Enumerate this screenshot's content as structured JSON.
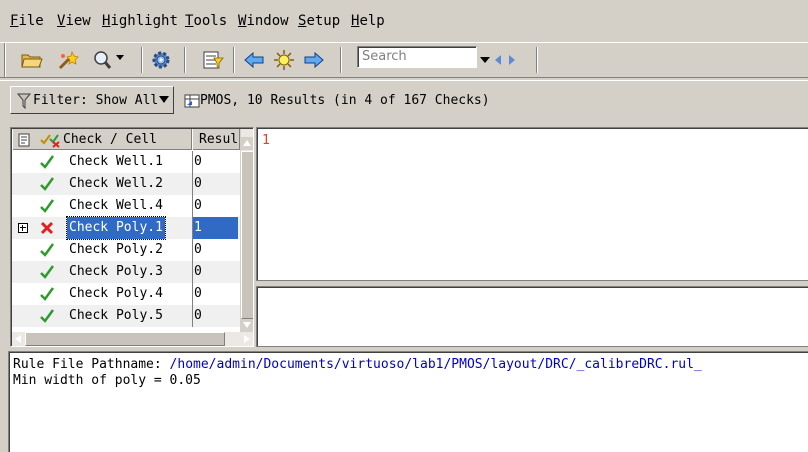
{
  "menu": {
    "items": [
      {
        "first": "F",
        "rest": "ile"
      },
      {
        "first": "V",
        "rest": "iew"
      },
      {
        "first": "H",
        "rest": "ighlight"
      },
      {
        "first": "T",
        "rest": "ools"
      },
      {
        "first": "W",
        "rest": "indow"
      },
      {
        "first": "S",
        "rest": "etup"
      },
      {
        "first": "H",
        "rest": "elp"
      }
    ]
  },
  "toolbar": {
    "search_placeholder": "Search",
    "icons": [
      "folder-open-icon",
      "highlight-wand-icon",
      "zoom-menu-icon",
      "gear-icon",
      "filter-table-icon",
      "back-arrow-icon",
      "sun-icon",
      "forward-arrow-icon",
      "search-prev-icon",
      "search-next-icon"
    ]
  },
  "filter": {
    "label": "Filter: Show All",
    "summary": "PMOS, 10 Results (in 4 of 167 Checks)"
  },
  "tree": {
    "col_check": "Check / Cell",
    "col_results": "Resul",
    "rows": [
      {
        "name": "Check Well.1",
        "results": "0",
        "status": "pass",
        "selected": false
      },
      {
        "name": "Check Well.2",
        "results": "0",
        "status": "pass",
        "selected": false
      },
      {
        "name": "Check Well.4",
        "results": "0",
        "status": "pass",
        "selected": false
      },
      {
        "name": "Check Poly.1",
        "results": "1",
        "status": "fail",
        "selected": true
      },
      {
        "name": "Check Poly.2",
        "results": "0",
        "status": "pass",
        "selected": false
      },
      {
        "name": "Check Poly.3",
        "results": "0",
        "status": "pass",
        "selected": false
      },
      {
        "name": "Check Poly.4",
        "results": "0",
        "status": "pass",
        "selected": false
      },
      {
        "name": "Check Poly.5",
        "results": "0",
        "status": "pass",
        "selected": false
      }
    ]
  },
  "results": {
    "items": [
      "1"
    ]
  },
  "info": {
    "rule_label": "Rule File Pathname: ",
    "rule_path": "/home/admin/Documents/virtuoso/lab1/PMOS/layout/DRC/_calibreDRC.rul_",
    "description": "Min width of poly = 0.05"
  },
  "colors": {
    "pass": "#2e9a2e",
    "fail": "#e02020",
    "selection": "#316ac5",
    "path": "#0000c8",
    "result_item": "#e0401c"
  }
}
